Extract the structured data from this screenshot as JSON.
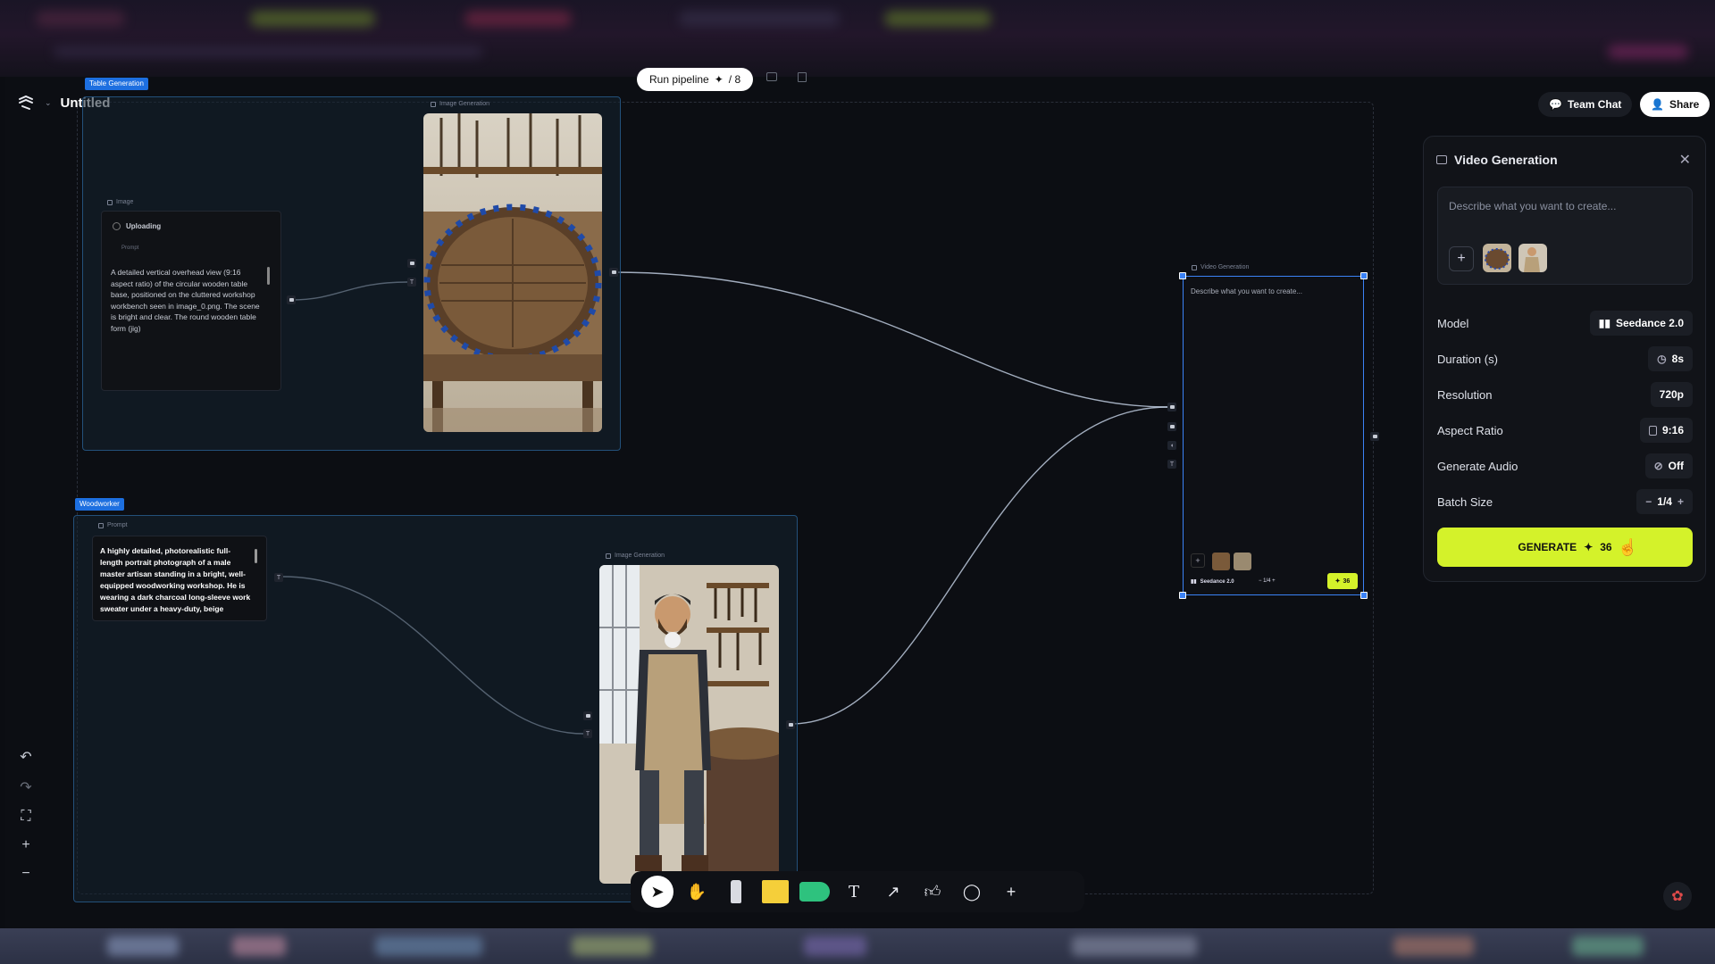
{
  "app": {
    "title": "Untitled"
  },
  "topbar": {
    "run_pipeline": "Run pipeline",
    "run_count": "/ 8",
    "team_chat": "Team Chat",
    "share": "Share"
  },
  "groups": {
    "table_generation": {
      "tag": "Table Generation"
    },
    "woodworker": {
      "tag": "Woodworker"
    }
  },
  "nodes": {
    "image_node": {
      "header": "Image",
      "status": "Uploading",
      "prompt_label": "Prompt",
      "text": "A detailed vertical overhead view (9:16 aspect ratio) of the circular wooden table base, positioned on the cluttered workshop workbench seen in image_0.png. The scene is bright and clear. The round wooden table form (jig)"
    },
    "image_gen_top": {
      "header": "Image Generation"
    },
    "prompt_node": {
      "header": "Prompt",
      "text": "A highly detailed, photorealistic full-length portrait photograph of a male master artisan standing in a bright, well-equipped woodworking workshop. He is wearing a dark charcoal long-sleeve work sweater under a heavy-duty, beige"
    },
    "image_gen_bottom": {
      "header": "Image Generation"
    },
    "video_node": {
      "header": "Video Generation",
      "placeholder": "Describe what you want to create...",
      "model": "Seedance 2.0",
      "batch": "1/4",
      "credits": "36"
    }
  },
  "panel": {
    "title": "Video Generation",
    "prompt_placeholder": "Describe what you want to create...",
    "settings": [
      {
        "label": "Model",
        "value": "Seedance 2.0",
        "icon": "bars-icon"
      },
      {
        "label": "Duration (s)",
        "value": "8s",
        "icon": "clock-icon"
      },
      {
        "label": "Resolution",
        "value": "720p",
        "icon": ""
      },
      {
        "label": "Aspect Ratio",
        "value": "9:16",
        "icon": "square-icon"
      },
      {
        "label": "Generate Audio",
        "value": "Off",
        "icon": "mute-icon"
      },
      {
        "label": "Batch Size",
        "value": "1/4",
        "icon": ""
      }
    ],
    "generate_label": "GENERATE",
    "generate_cost": "36"
  },
  "colors": {
    "accent": "#d4f22a",
    "selection": "#3b82f6",
    "group_tag": "#1d6fe0"
  }
}
